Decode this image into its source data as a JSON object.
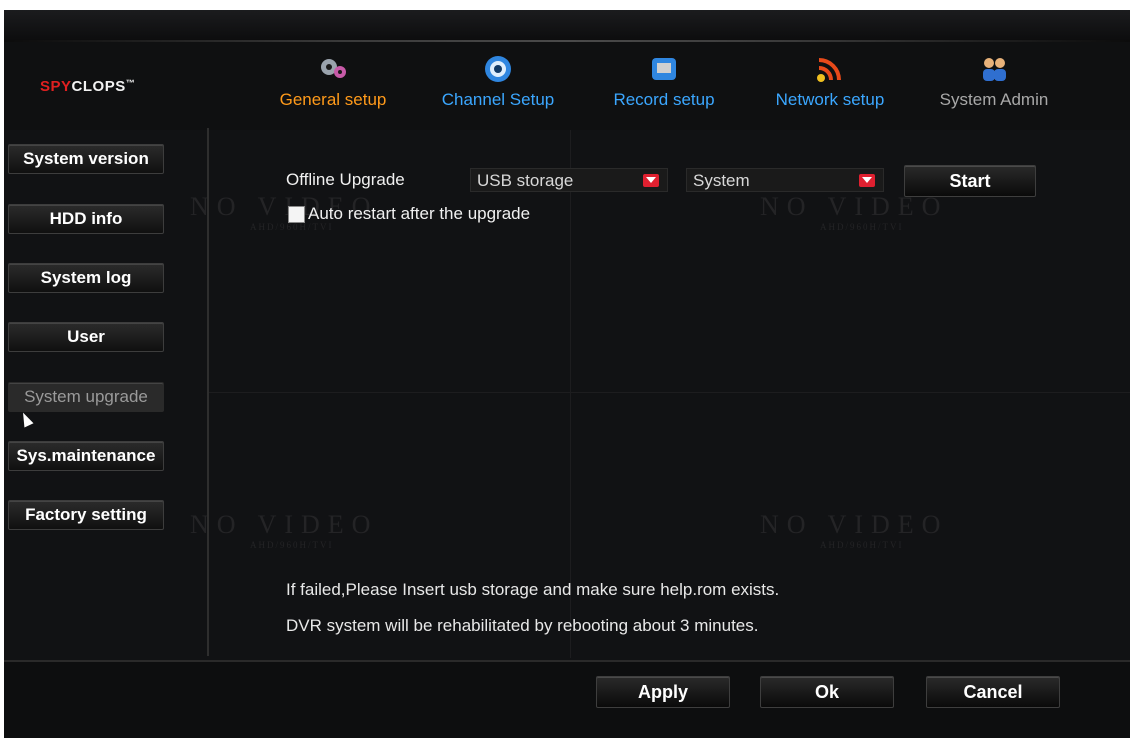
{
  "brand": {
    "logo_prefix": "SPY",
    "logo_main": "CL",
    "logo_o": "O",
    "logo_end": "PS",
    "tm": "™"
  },
  "nav": {
    "tabs": [
      {
        "label": "General setup",
        "icon": "gears-icon",
        "color": "#ff9a1a",
        "active": true
      },
      {
        "label": "Channel Setup",
        "icon": "camera-lens-icon",
        "color": "#3ba7ff",
        "active": false
      },
      {
        "label": "Record setup",
        "icon": "video-recorder-icon",
        "color": "#3ba7ff",
        "active": false
      },
      {
        "label": "Network setup",
        "icon": "wifi-signal-icon",
        "color": "#3ba7ff",
        "active": false
      },
      {
        "label": "System Admin",
        "icon": "users-icon",
        "color": "#a8a8a8",
        "active": false
      }
    ]
  },
  "sidebar": {
    "items": [
      {
        "label": "System version"
      },
      {
        "label": "HDD info"
      },
      {
        "label": "System log"
      },
      {
        "label": "User"
      },
      {
        "label": "System upgrade",
        "active": true
      },
      {
        "label": "Sys.maintenance"
      },
      {
        "label": "Factory setting"
      }
    ]
  },
  "upgrade": {
    "label": "Offline Upgrade",
    "source_value": "USB storage",
    "target_value": "System",
    "start_label": "Start",
    "auto_restart_label": "Auto restart after the upgrade",
    "auto_restart_checked": false
  },
  "background": {
    "no_video": "NO VIDEO",
    "no_video_sub": "AHD/960H/TVI"
  },
  "messages": {
    "line1": "If failed,Please Insert usb storage and make sure help.rom exists.",
    "line2": "DVR system will be rehabilitated by rebooting about 3 minutes."
  },
  "footer": {
    "apply_label": "Apply",
    "ok_label": "Ok",
    "cancel_label": "Cancel"
  },
  "colors": {
    "accent_orange": "#ff9a1a",
    "tab_blue": "#3ba7ff",
    "dropdown_red": "#e02030",
    "background": "#111214"
  }
}
